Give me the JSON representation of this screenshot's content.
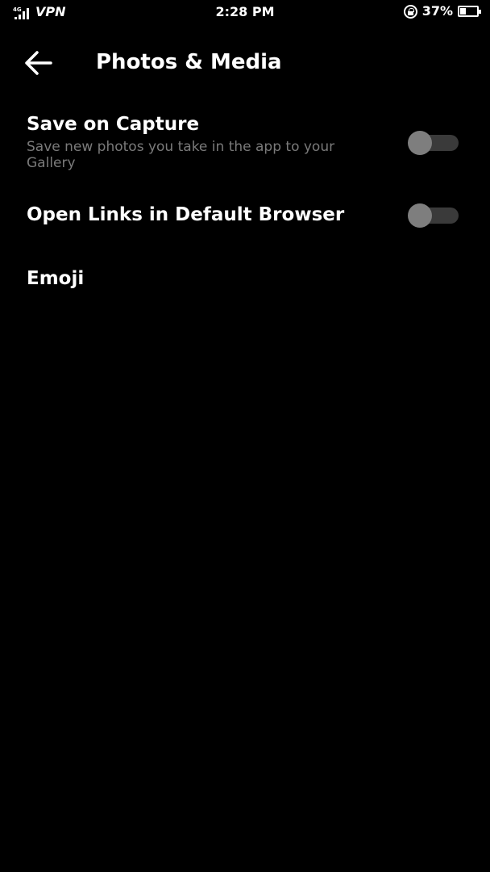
{
  "status_bar": {
    "network": "4G",
    "vpn": "VPN",
    "time": "2:28 PM",
    "battery_percent": "37%",
    "battery_level": 0.37
  },
  "header": {
    "title": "Photos & Media",
    "back_icon": "back-arrow-icon"
  },
  "settings": {
    "save_on_capture": {
      "title": "Save on Capture",
      "description": "Save new photos you take in the app to your Gallery",
      "enabled": false
    },
    "open_links": {
      "title": "Open Links in Default Browser",
      "enabled": false
    },
    "emoji": {
      "title": "Emoji"
    }
  },
  "colors": {
    "background": "#000000",
    "text_primary": "#ffffff",
    "text_secondary": "#7a7a7a",
    "toggle_track_off": "#3a3a3a",
    "toggle_knob_off": "#7e7e7e"
  }
}
